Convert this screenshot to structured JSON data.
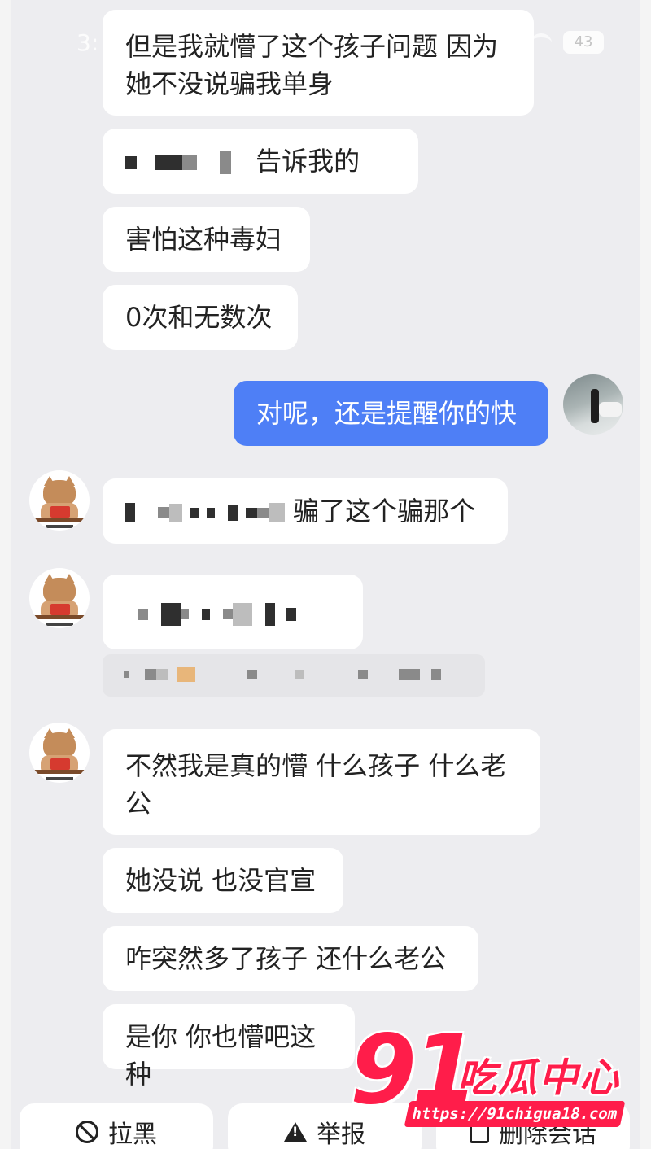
{
  "status_bar": {
    "time": "3:",
    "battery": "43"
  },
  "messages": [
    {
      "id": "m1",
      "sender": "other",
      "text": "但是我就懵了这个孩子问题 因为她不没说骗我单身"
    },
    {
      "id": "m2",
      "sender": "other",
      "text": "告诉我的",
      "partially_pixelated": true
    },
    {
      "id": "m3",
      "sender": "other",
      "text": "害怕这种毒妇"
    },
    {
      "id": "m4",
      "sender": "other",
      "text": "0次和无数次"
    },
    {
      "id": "m5",
      "sender": "me",
      "text": "对呢，还是提醒你的快"
    },
    {
      "id": "m6",
      "sender": "other",
      "text": "骗了这个骗那个",
      "partially_pixelated": true
    },
    {
      "id": "m7",
      "sender": "other",
      "text": "",
      "fully_pixelated": true
    },
    {
      "id": "m8",
      "sender": "other",
      "text": "不然我是真的懵 什么孩子 什么老公"
    },
    {
      "id": "m9",
      "sender": "other",
      "text": "她没说 也没官宣"
    },
    {
      "id": "m10",
      "sender": "other",
      "text": "咋突然多了孩子 还什么老公"
    },
    {
      "id": "m11",
      "sender": "other",
      "text": "是你 你也懵吧这种"
    }
  ],
  "avatars": {
    "other": {
      "icon": "cat-reading-avatar-icon"
    },
    "me": {
      "icon": "photo-avatar-icon"
    }
  },
  "footer": {
    "block_label": "拉黑",
    "report_label": "举报",
    "delete_label": "删除会话"
  },
  "watermark": {
    "number": "91",
    "name": "吃瓜中心",
    "url": "https://91chigua18.com"
  },
  "colors": {
    "background": "#ededf0",
    "bubble_other": "#ffffff",
    "bubble_me": "#4e7ff6",
    "watermark": "#ff1d4a"
  }
}
